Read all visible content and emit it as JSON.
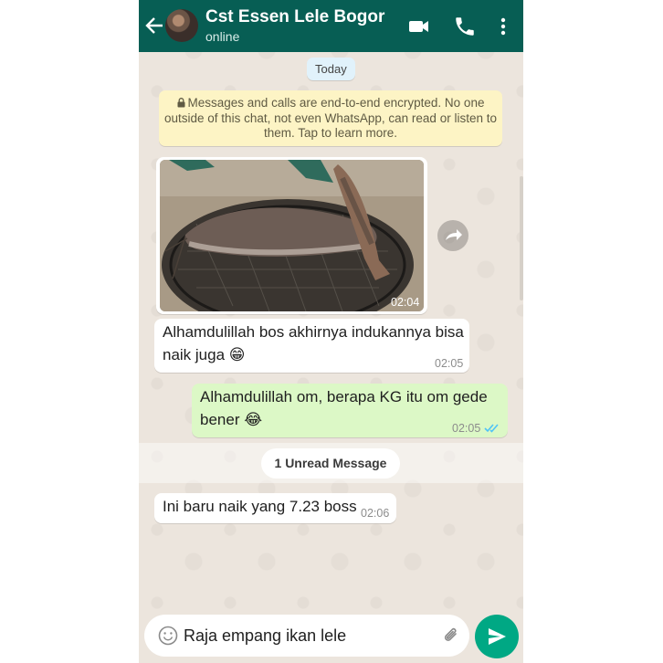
{
  "header": {
    "contact_name": "Cst Essen Lele Bogor",
    "status": "online"
  },
  "date_label": "Today",
  "encryption_notice": "Messages and calls are end-to-end encrypted. No one outside of this chat, not even WhatsApp, can read or listen to them. Tap to learn more.",
  "messages": [
    {
      "direction": "incoming",
      "type": "image",
      "time": "02:04"
    },
    {
      "direction": "incoming",
      "type": "text",
      "line1": "Alhamdulillah bos akhirnya indukannya bisa",
      "line2": "naik juga 😁",
      "time": "02:05"
    },
    {
      "direction": "outgoing",
      "type": "text",
      "line1": "Alhamdulillah om, berapa KG itu om gede",
      "line2": "bener 😂",
      "time": "02:05",
      "status": "read"
    },
    {
      "direction": "incoming",
      "type": "text",
      "text": "Ini baru naik yang 7.23 boss",
      "time": "02:06"
    }
  ],
  "unread_divider": "1 Unread Message",
  "composer": {
    "draft_text": "Raja empang ikan lele"
  },
  "colors": {
    "header": "#075e54",
    "outgoing_bubble": "#dcf8c6",
    "send_button": "#00a884",
    "read_tick": "#4fc3f7"
  }
}
